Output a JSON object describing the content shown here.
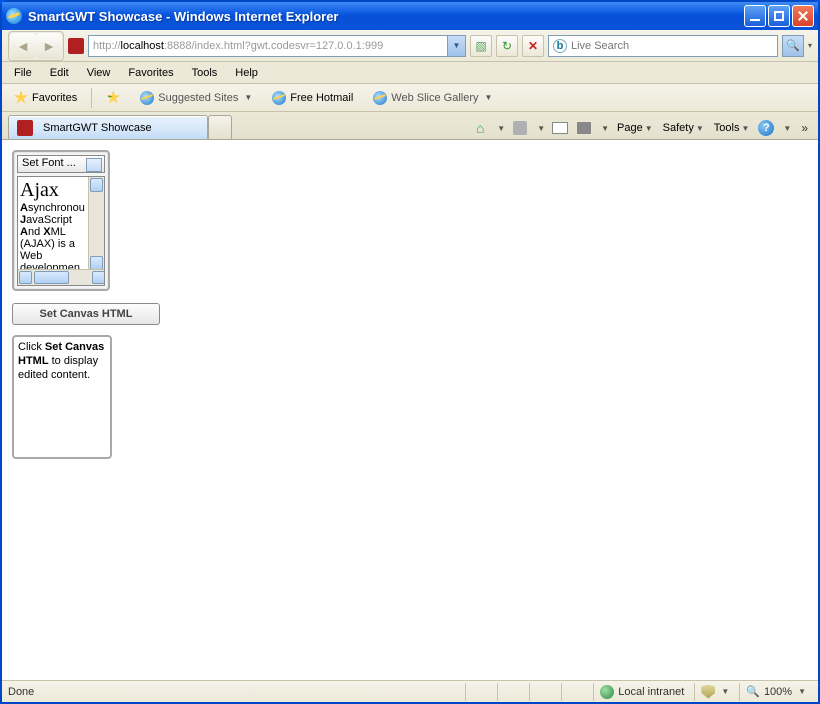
{
  "window": {
    "title": "SmartGWT Showcase - Windows Internet Explorer"
  },
  "nav": {
    "url_prefix": "http://",
    "url_host": "localhost",
    "url_suffix": ":8888/index.html?gwt.codesvr=127.0.0.1:999",
    "search_placeholder": "Live Search"
  },
  "menu": {
    "items": [
      "File",
      "Edit",
      "View",
      "Favorites",
      "Tools",
      "Help"
    ]
  },
  "favbar": {
    "favorites": "Favorites",
    "suggested": "Suggested Sites",
    "hotmail": "Free Hotmail",
    "webslice": "Web Slice Gallery"
  },
  "tabs": {
    "active": "SmartGWT Showcase",
    "cmdbar": {
      "page": "Page",
      "safety": "Safety",
      "tools": "Tools"
    }
  },
  "editor": {
    "font_combo": "Set Font ...",
    "heading": "Ajax",
    "line1a": "A",
    "line1b": "synchronou",
    "line2a": "J",
    "line2b": "avaScript",
    "line3a": "A",
    "line3b": "nd ",
    "line3c": "X",
    "line3d": "ML",
    "line4": "(AJAX) is a",
    "line5": "Web",
    "line6": "developmen",
    "button": "Set Canvas HTML",
    "canvas1": "Click ",
    "canvas2": "Set Canvas HTML",
    "canvas3": " to display edited content."
  },
  "status": {
    "done": "Done",
    "zone": "Local intranet",
    "zoom": "100%"
  }
}
